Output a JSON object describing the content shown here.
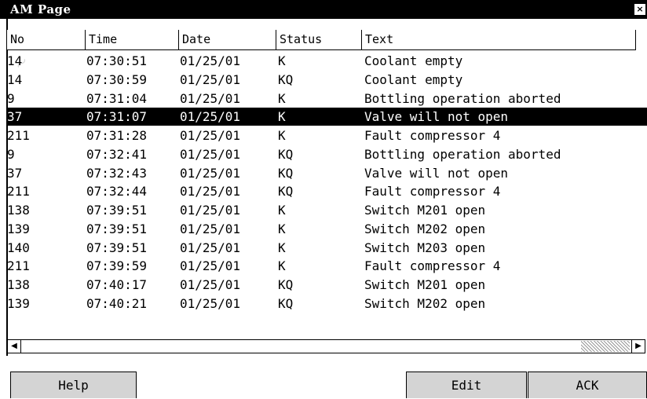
{
  "window": {
    "title": "AM Page",
    "close_icon": "×"
  },
  "table": {
    "columns": [
      "No",
      "Time",
      "Date",
      "Status",
      "Text"
    ],
    "rows": [
      {
        "no": "14",
        "time": "07:30:51",
        "date": "01/25/01",
        "status": "K",
        "text": "Coolant empty"
      },
      {
        "no": "14",
        "time": "07:30:59",
        "date": "01/25/01",
        "status": "KQ",
        "text": "Coolant empty"
      },
      {
        "no": "9",
        "time": "07:31:04",
        "date": "01/25/01",
        "status": "K",
        "text": "Bottling operation aborted"
      },
      {
        "no": "37",
        "time": "07:31:07",
        "date": "01/25/01",
        "status": "K",
        "text": "Valve will not open"
      },
      {
        "no": "211",
        "time": "07:31:28",
        "date": "01/25/01",
        "status": "K",
        "text": "Fault compressor 4"
      },
      {
        "no": "9",
        "time": "07:32:41",
        "date": "01/25/01",
        "status": "KQ",
        "text": "Bottling operation aborted"
      },
      {
        "no": "37",
        "time": "07:32:43",
        "date": "01/25/01",
        "status": "KQ",
        "text": "Valve will not open"
      },
      {
        "no": "211",
        "time": "07:32:44",
        "date": "01/25/01",
        "status": "KQ",
        "text": "Fault compressor 4"
      },
      {
        "no": "138",
        "time": "07:39:51",
        "date": "01/25/01",
        "status": "K",
        "text": "Switch M201 open"
      },
      {
        "no": "139",
        "time": "07:39:51",
        "date": "01/25/01",
        "status": "K",
        "text": "Switch M202 open"
      },
      {
        "no": "140",
        "time": "07:39:51",
        "date": "01/25/01",
        "status": "K",
        "text": "Switch M203 open"
      },
      {
        "no": "211",
        "time": "07:39:59",
        "date": "01/25/01",
        "status": "K",
        "text": "Fault compressor 4"
      },
      {
        "no": "138",
        "time": "07:40:17",
        "date": "01/25/01",
        "status": "KQ",
        "text": "Switch M201 open"
      },
      {
        "no": "139",
        "time": "07:40:21",
        "date": "01/25/01",
        "status": "KQ",
        "text": "Switch M202 open"
      }
    ],
    "selected_index": 3
  },
  "scrollbar": {
    "left_icon": "◀",
    "right_icon": "▶"
  },
  "buttons": {
    "help": "Help",
    "edit": "Edit",
    "ack": "ACK"
  }
}
